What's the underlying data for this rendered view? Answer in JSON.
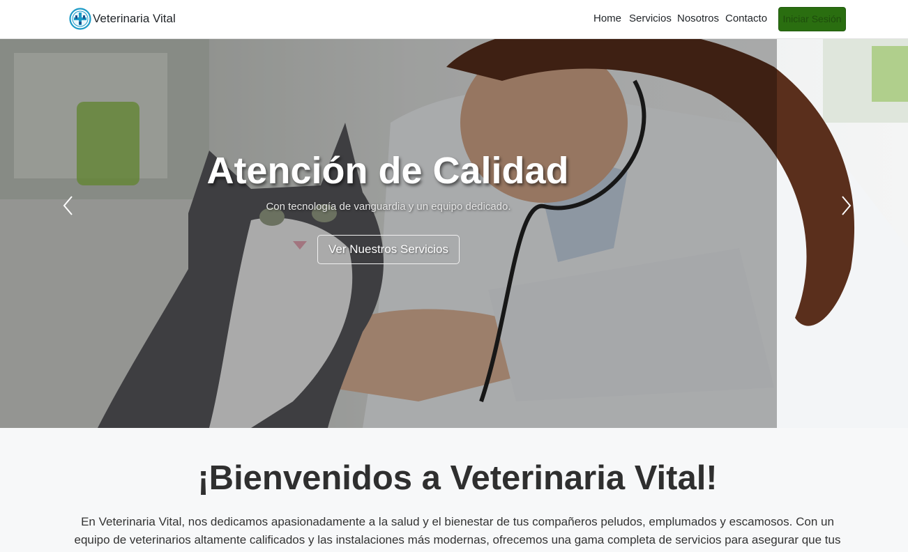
{
  "navbar": {
    "brand": "Veterinaria Vital",
    "links": [
      "Home",
      "Servicios",
      "Nosotros",
      "Contacto"
    ],
    "login_label": "Iniciar Sesión"
  },
  "hero": {
    "title": "Atención de Calidad",
    "subtitle": "Con tecnología de vanguardia y un equipo dedicado.",
    "cta_label": "Ver Nuestros Servicios"
  },
  "welcome": {
    "title": "¡Bienvenidos a Veterinaria Vital!",
    "text": "En Veterinaria Vital, nos dedicamos apasionadamente a la salud y el bienestar de tus compañeros peludos, emplumados y escamosos. Con un equipo de veterinarios altamente calificados y las instalaciones más modernas, ofrecemos una gama completa de servicios para asegurar que tus"
  },
  "colors": {
    "brand_teal": "#1d9bc7",
    "login_green": "#2a6e10",
    "section_bg": "#f7f8f9"
  },
  "icons": {
    "brand": "vet-clinic-logo-icon",
    "prev": "chevron-left-icon",
    "next": "chevron-right-icon"
  }
}
